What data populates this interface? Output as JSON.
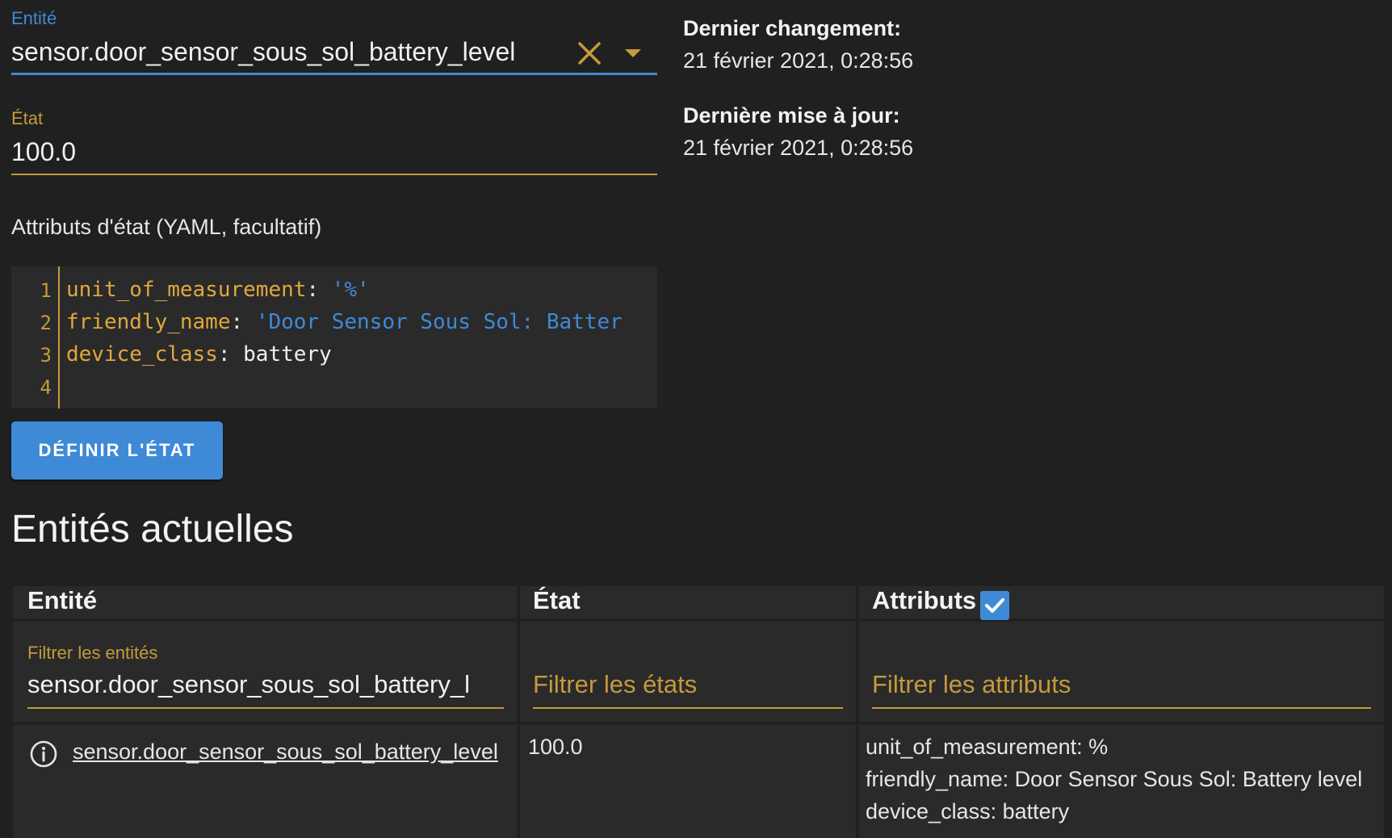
{
  "setter": {
    "entity_label": "Entité",
    "entity_value": "sensor.door_sensor_sous_sol_battery_level",
    "state_label": "État",
    "state_value": "100.0",
    "attributes_title": "Attributs d'état (YAML, facultatif)",
    "yaml_lines": [
      {
        "num": "1",
        "key": "unit_of_measurement",
        "sep": ": ",
        "value": "'%'",
        "value_type": "string"
      },
      {
        "num": "2",
        "key": "friendly_name",
        "sep": ": ",
        "value": "'Door Sensor Sous Sol: Batter",
        "value_type": "string"
      },
      {
        "num": "3",
        "key": "device_class",
        "sep": ": ",
        "value": "battery",
        "value_type": "plain"
      },
      {
        "num": "4",
        "key": "",
        "sep": "",
        "value": "",
        "value_type": "plain"
      }
    ],
    "set_button_label": "DÉFINIR L'ÉTAT"
  },
  "info": {
    "last_changed_label": "Dernier changement:",
    "last_changed_value": "21 février 2021, 0:28:56",
    "last_updated_label": "Dernière mise à jour:",
    "last_updated_value": "21 février 2021, 0:28:56"
  },
  "current": {
    "title": "Entités actuelles",
    "headers": {
      "entity": "Entité",
      "state": "État",
      "attributes": "Attributs"
    },
    "attributes_checked": true,
    "filters": {
      "entity_label": "Filtrer les entités",
      "entity_value": "sensor.door_sensor_sous_sol_battery_l",
      "state_placeholder": "Filtrer les états",
      "attributes_placeholder": "Filtrer les attributs"
    },
    "rows": [
      {
        "entity": "sensor.door_sensor_sous_sol_battery_level",
        "state": "100.0",
        "attributes": [
          "unit_of_measurement: %",
          "friendly_name: Door Sensor Sous Sol: Battery level",
          "device_class: battery"
        ]
      }
    ]
  },
  "colors": {
    "background": "#202021",
    "panel": "#2a2a2b",
    "primary": "#3f8ad6",
    "accent": "#c59a3a"
  },
  "icons": {
    "clear": "close-icon",
    "dropdown": "caret-down-icon",
    "info": "info-circle-icon",
    "check": "check-icon"
  }
}
